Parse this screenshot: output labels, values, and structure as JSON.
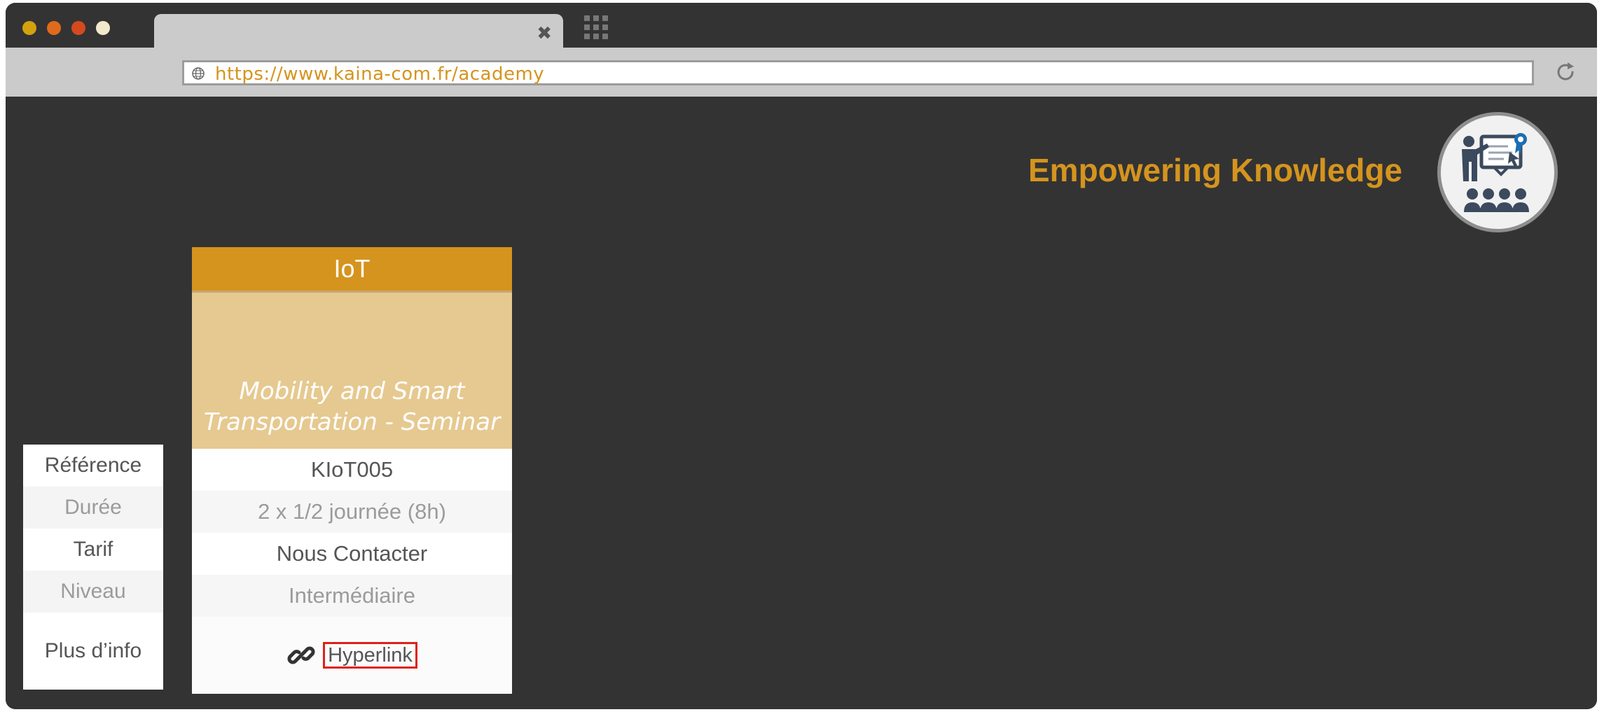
{
  "browser": {
    "window_dots": [
      "#d4a20f",
      "#e06a1b",
      "#d44a1e",
      "#f2e8cc"
    ],
    "tab": {
      "close_icon": "close-icon"
    },
    "apps_icon": "grid-icon",
    "url": "https://www.kaina-com.fr/academy",
    "reload_icon": "reload-icon"
  },
  "header": {
    "tagline": "Empowering Knowledge",
    "logo_icon": "presenter-audience-icon"
  },
  "labels": [
    "Référence",
    "Durée",
    "Tarif",
    "Niveau",
    "Plus d’info"
  ],
  "course": {
    "category": "IoT",
    "title_line1": "Mobility and Smart",
    "title_line2": "Transportation - Seminar",
    "reference": "KIoT005",
    "duration": "2 x 1/2 journée (8h)",
    "price": "Nous Contacter",
    "level": "Intermédiaire",
    "link_label": "Hyperlink"
  },
  "colors": {
    "accent": "#d4941e",
    "background": "#333333",
    "title_panel": "#e6c990",
    "link_border": "#e0201b"
  }
}
